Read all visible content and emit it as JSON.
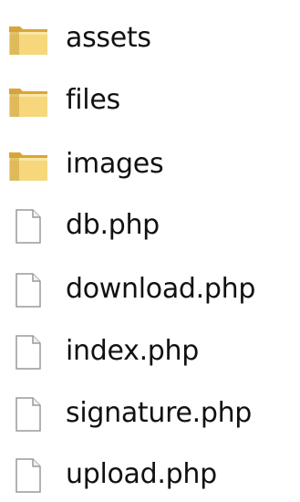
{
  "explorer": {
    "items": [
      {
        "name": "assets",
        "type": "folder",
        "icon": "folder-icon"
      },
      {
        "name": "files",
        "type": "folder",
        "icon": "folder-icon"
      },
      {
        "name": "images",
        "type": "folder",
        "icon": "folder-icon"
      },
      {
        "name": "db.php",
        "type": "file",
        "icon": "file-icon"
      },
      {
        "name": "download.php",
        "type": "file",
        "icon": "file-icon"
      },
      {
        "name": "index.php",
        "type": "file",
        "icon": "file-icon"
      },
      {
        "name": "signature.php",
        "type": "file",
        "icon": "file-icon"
      },
      {
        "name": "upload.php",
        "type": "file",
        "icon": "file-icon"
      }
    ]
  },
  "colors": {
    "folder_light": "#f6d77b",
    "folder_dark": "#d9a637",
    "file_border": "#9a9a9a"
  }
}
